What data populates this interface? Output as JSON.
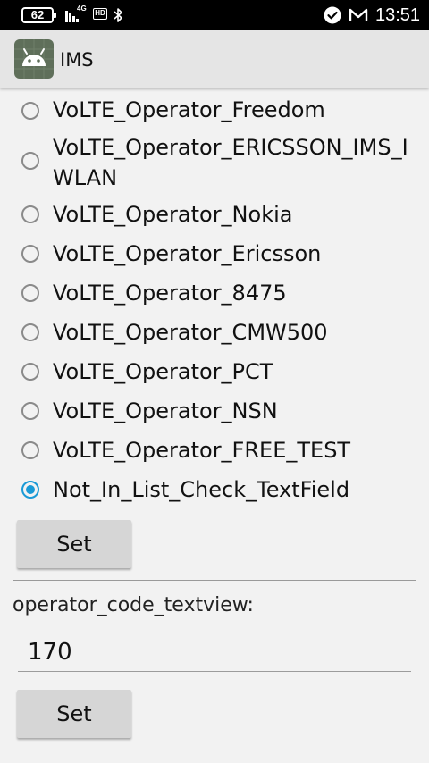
{
  "status_bar": {
    "battery": "62",
    "network": "4G",
    "hd_badge": "HD",
    "time": "13:51"
  },
  "app_bar": {
    "title": "IMS",
    "icon": "android-icon"
  },
  "operator_options": [
    {
      "label": "VoLTE_Operator_Freedom",
      "checked": false
    },
    {
      "label": "VoLTE_Operator_ERICSSON_IMS_IWLAN",
      "checked": false
    },
    {
      "label": "VoLTE_Operator_Nokia",
      "checked": false
    },
    {
      "label": "VoLTE_Operator_Ericsson",
      "checked": false
    },
    {
      "label": "VoLTE_Operator_8475",
      "checked": false
    },
    {
      "label": "VoLTE_Operator_CMW500",
      "checked": false
    },
    {
      "label": "VoLTE_Operator_PCT",
      "checked": false
    },
    {
      "label": "VoLTE_Operator_NSN",
      "checked": false
    },
    {
      "label": "VoLTE_Operator_FREE_TEST",
      "checked": false
    },
    {
      "label": "Not_In_List_Check_TextField",
      "checked": true
    }
  ],
  "set_button_1": {
    "label": "Set"
  },
  "operator_code": {
    "label": "operator_code_textview:",
    "value": "170"
  },
  "set_button_2": {
    "label": "Set"
  },
  "colors": {
    "accent": "#1a9ad6",
    "status_bar_bg": "#000000",
    "app_bar_bg": "#e5e5e5",
    "page_bg": "#f2f2f2",
    "button_bg": "#d6d6d6"
  }
}
